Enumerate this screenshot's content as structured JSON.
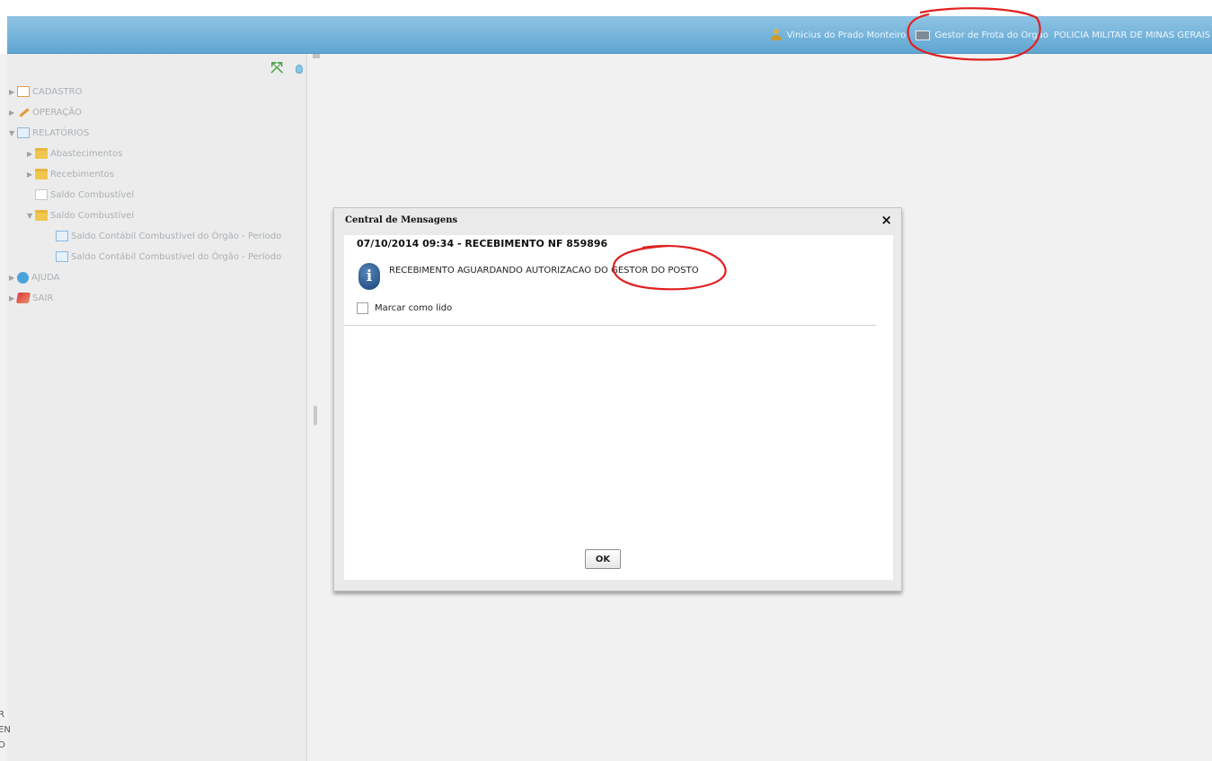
{
  "header": {
    "user_name": "Vinicius do Prado Monteiro",
    "role": "Gestor de Frota do Orgão",
    "organization": "POLICIA MILITAR DE MINAS GERAIS"
  },
  "sidebar": {
    "items": [
      {
        "label": "CADASTRO",
        "arrow": "▶",
        "icon": "document-icon"
      },
      {
        "label": "OPERAÇÃO",
        "arrow": "▶",
        "icon": "wrench-icon"
      },
      {
        "label": "RELATÓRIOS",
        "arrow": "▼",
        "icon": "report-icon"
      },
      {
        "label": "Abastecimentos",
        "arrow": "▶",
        "icon": "folder-icon"
      },
      {
        "label": "Recebimentos",
        "arrow": "▶",
        "icon": "folder-icon"
      },
      {
        "label": "Saldo Combustível",
        "arrow": "",
        "icon": "document-icon"
      },
      {
        "label": "Saldo Combustível",
        "arrow": "▼",
        "icon": "folder-icon"
      },
      {
        "label": "Saldo Contábil Combustível do Órgão - Período",
        "arrow": "",
        "icon": "report-icon"
      },
      {
        "label": "Saldo Contábil Combustível do Órgão - Período",
        "arrow": "",
        "icon": "report-icon"
      },
      {
        "label": "AJUDA",
        "arrow": "▶",
        "icon": "help-icon"
      },
      {
        "label": "SAIR",
        "arrow": "▶",
        "icon": "exit-icon"
      }
    ]
  },
  "edge_text": [
    "R",
    "EN",
    "O"
  ],
  "dialog": {
    "title": "Central de Mensagens",
    "close": "×",
    "message_header": "07/10/2014 09:34 - RECEBIMENTO NF 859896",
    "message_text": "RECEBIMENTO AGUARDANDO AUTORIZACAO DO GESTOR DO POSTO",
    "checkbox_label": "Marcar como lido",
    "ok_label": "OK",
    "info_glyph": "i"
  },
  "colors": {
    "header_bar": "#6caed7",
    "annotation": "#e02020"
  }
}
